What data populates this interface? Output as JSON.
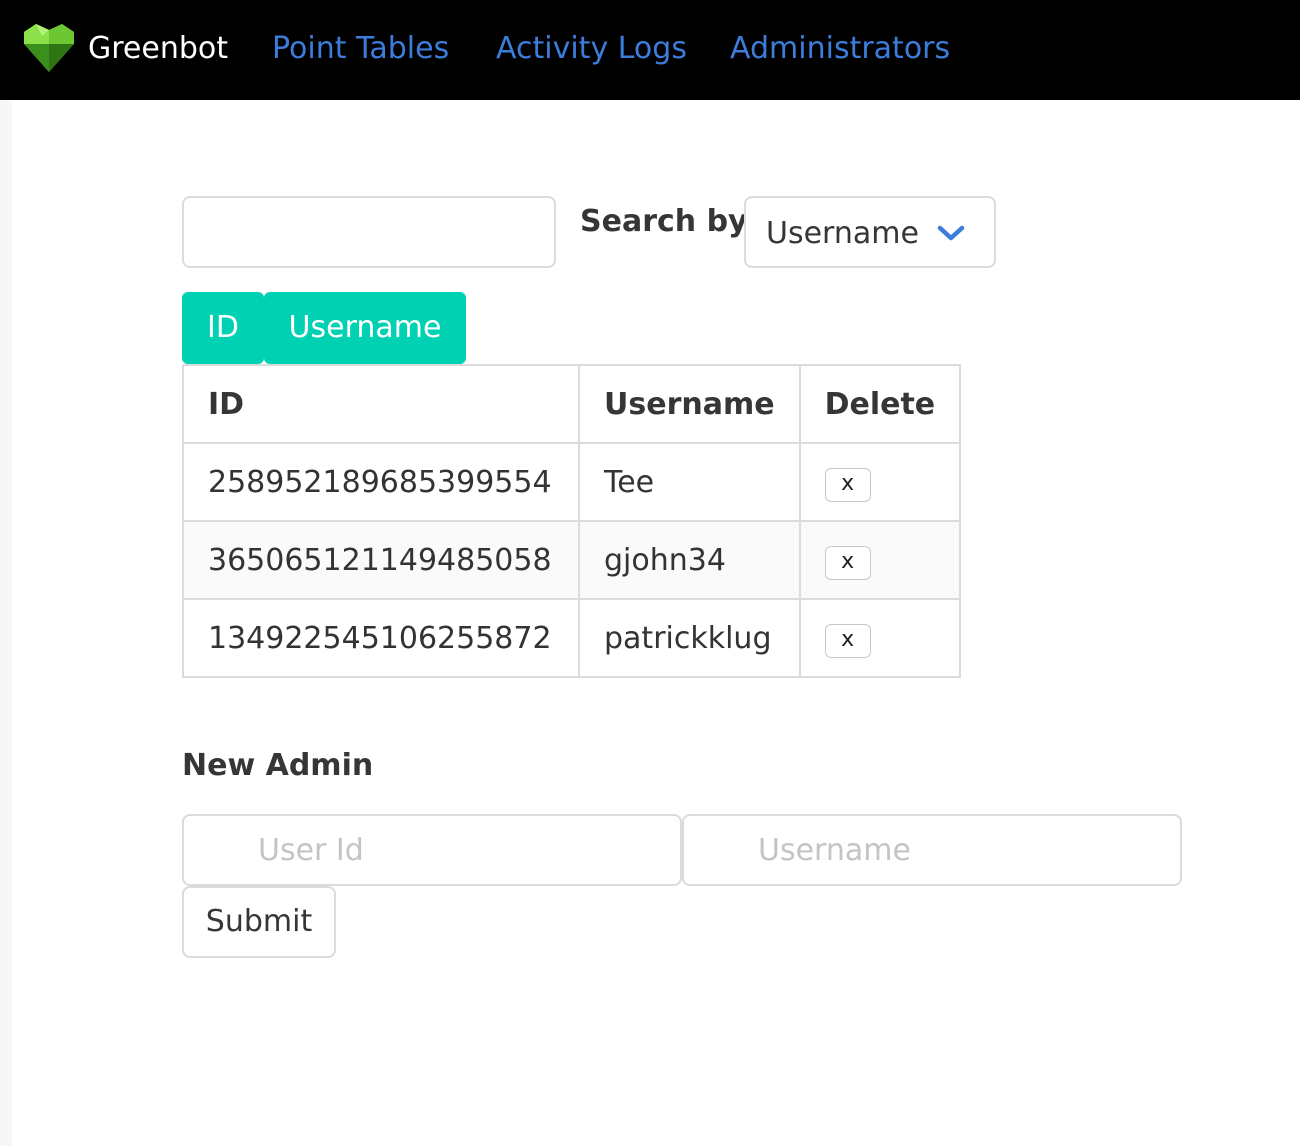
{
  "navbar": {
    "brand": "Greenbot",
    "logo_icon": "green-heart-gem-icon",
    "links": [
      "Point Tables",
      "Activity Logs",
      "Administrators"
    ],
    "link_color": "#3c7ddc"
  },
  "search": {
    "value": "",
    "label": "Search by:",
    "select_value": "Username",
    "chevron_icon": "chevron-down-icon"
  },
  "sort_buttons": [
    "ID",
    "Username"
  ],
  "table": {
    "headers": [
      "ID",
      "Username",
      "Delete"
    ],
    "rows": [
      {
        "id": "258952189685399554",
        "username": "Tee",
        "delete": "x"
      },
      {
        "id": "365065121149485058",
        "username": "gjohn34",
        "delete": "x"
      },
      {
        "id": "134922545106255872",
        "username": "patrickklug",
        "delete": "x"
      }
    ]
  },
  "new_admin": {
    "title": "New Admin",
    "user_id_placeholder": "User Id",
    "username_placeholder": "Username",
    "submit_label": "Submit"
  },
  "colors": {
    "accent": "#00d1b2",
    "navbar_bg": "#000000"
  }
}
